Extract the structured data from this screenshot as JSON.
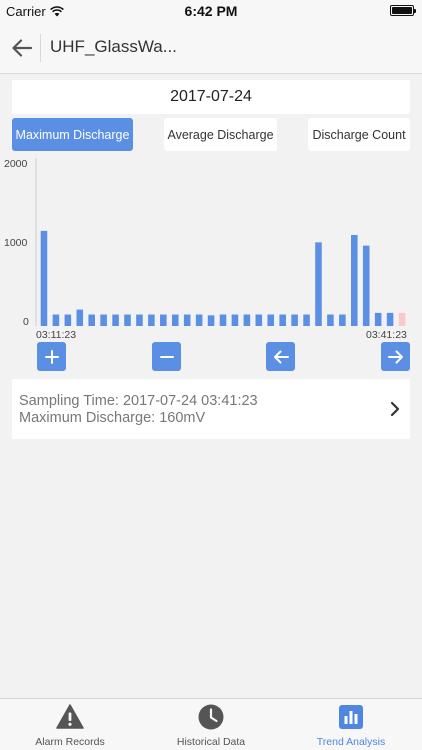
{
  "status_bar": {
    "carrier": "Carrier",
    "time": "6:42 PM",
    "wifi_icon": "wifi-icon",
    "battery_icon": "battery-icon"
  },
  "nav": {
    "title": "UHF_GlassWa...",
    "back_icon": "arrow-left-icon"
  },
  "date": "2017-07-24",
  "tabs": [
    {
      "label": "Maximum Discharge",
      "active": true
    },
    {
      "label": "Average Discharge",
      "active": false
    },
    {
      "label": "Discharge Count",
      "active": false
    }
  ],
  "chart_data": {
    "type": "bar",
    "y_ticks": [
      "2000",
      "1000",
      "0"
    ],
    "ylim": [
      0,
      2000
    ],
    "x_start_label": "03:11:23",
    "x_end_label": "03:41:23",
    "values": [
      1160,
      140,
      140,
      200,
      140,
      140,
      140,
      140,
      140,
      140,
      140,
      140,
      140,
      140,
      130,
      140,
      140,
      140,
      140,
      140,
      140,
      140,
      140,
      1020,
      140,
      140,
      1110,
      980,
      160,
      160,
      160
    ],
    "bar_color": "#5b8fe4",
    "selected_index": 30,
    "selected_color": "#f9c8c8",
    "grid": false
  },
  "controls": {
    "zoom_in_icon": "plus-icon",
    "zoom_out_icon": "minus-icon",
    "prev_icon": "arrow-left-icon",
    "next_icon": "arrow-right-icon",
    "color": "#5b8fe4"
  },
  "info": {
    "sampling_line": "Sampling Time: 2017-07-24 03:41:23",
    "value_line": "Maximum Discharge: 160mV",
    "chevron_icon": "chevron-right-icon"
  },
  "tab_bar": [
    {
      "label": "Alarm Records",
      "icon": "warning-triangle-icon",
      "active": false
    },
    {
      "label": "Historical Data",
      "icon": "clock-icon",
      "active": false
    },
    {
      "label": "Trend Analysis",
      "icon": "bar-chart-icon",
      "active": true
    }
  ],
  "colors": {
    "accent": "#5b8fe4",
    "tab_active_text": "#4f86e0"
  }
}
